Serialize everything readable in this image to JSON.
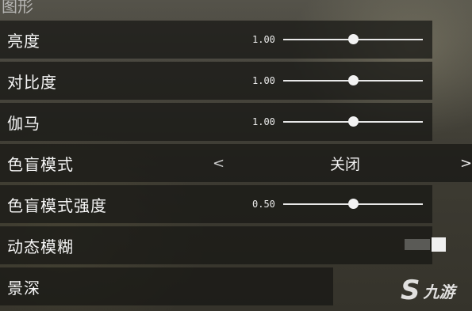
{
  "section": {
    "title": "图形"
  },
  "rows": [
    {
      "label": "亮度",
      "value": "1.00",
      "level": 0.5
    },
    {
      "label": "对比度",
      "value": "1.00",
      "level": 0.5
    },
    {
      "label": "伽马",
      "value": "1.00",
      "level": 0.5
    },
    {
      "label": "色盲模式",
      "selected": "关闭",
      "prev_symbol": "<",
      "next_symbol": ">"
    },
    {
      "label": "色盲模式强度",
      "value": "0.50",
      "level": 0.5
    },
    {
      "label": "动态模糊"
    },
    {
      "label": "景深"
    }
  ],
  "watermark": {
    "logo": "S",
    "text": "九游"
  }
}
